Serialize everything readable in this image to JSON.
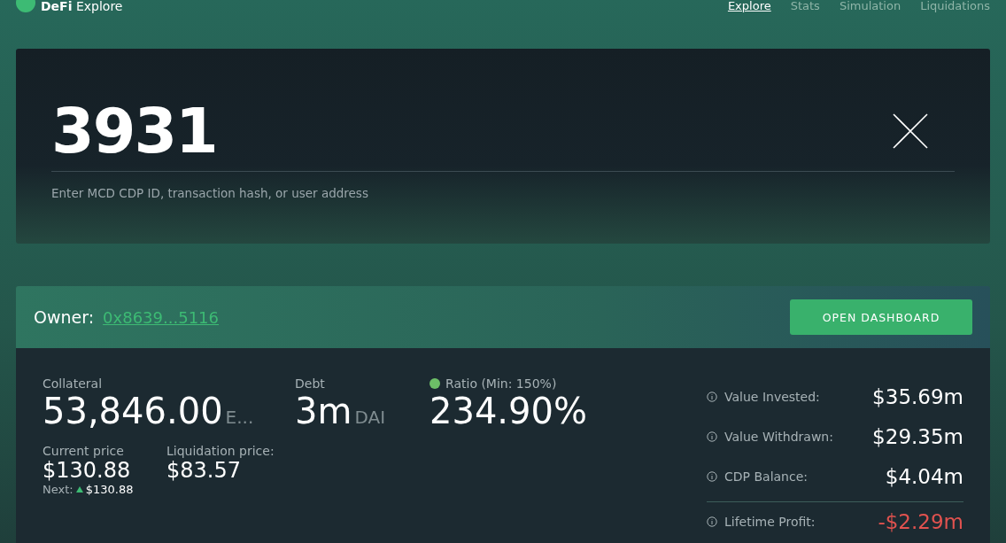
{
  "header": {
    "logo": {
      "bold": "DeFi",
      "light": "Explore"
    },
    "nav": [
      {
        "label": "Explore",
        "selected": true
      },
      {
        "label": "Stats",
        "selected": false
      },
      {
        "label": "Simulation",
        "selected": false
      },
      {
        "label": "Liquidations",
        "selected": false
      }
    ]
  },
  "search": {
    "value": "3931",
    "hint": "Enter MCD CDP ID, transaction hash, or user address"
  },
  "owner": {
    "label": "Owner:",
    "address": "0x8639...5116",
    "button": "OPEN DASHBOARD"
  },
  "stats": {
    "collateral": {
      "label": "Collateral",
      "value": "53,846.00",
      "unit": "E..."
    },
    "debt": {
      "label": "Debt",
      "value": "3m",
      "unit": "DAI"
    },
    "ratio": {
      "label": "Ratio (Min: 150%)",
      "value": "234.90%",
      "color": "#6dbf67"
    },
    "current_price": {
      "label": "Current price",
      "value": "$130.88",
      "next_label": "Next:",
      "next_value": "$130.88"
    },
    "liquidation_price": {
      "label": "Liquidation price:",
      "value": "$83.57"
    }
  },
  "summary": [
    {
      "label": "Value Invested:",
      "value": "$35.69m",
      "negative": false,
      "divider": false
    },
    {
      "label": "Value Withdrawn:",
      "value": "$29.35m",
      "negative": false,
      "divider": false
    },
    {
      "label": "CDP Balance:",
      "value": "$4.04m",
      "negative": false,
      "divider": false
    },
    {
      "label": "Lifetime Profit:",
      "value": "-$2.29m",
      "negative": true,
      "divider": true
    }
  ]
}
